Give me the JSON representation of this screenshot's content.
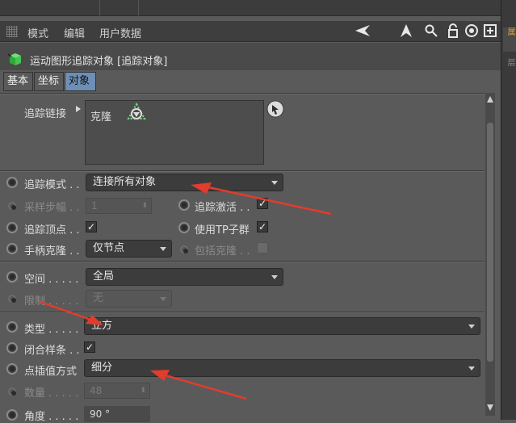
{
  "menu": {
    "mode": "模式",
    "edit": "编辑",
    "user_data": "用户数据"
  },
  "object": {
    "title": "运动图形追踪对象 [追踪对象]"
  },
  "tabs": [
    "基本",
    "坐标",
    "对象"
  ],
  "fields": {
    "trace_link_label": "追踪链接",
    "trace_link_item": "克隆",
    "trace_mode_label": "追踪模式 . .",
    "trace_mode_value": "连接所有对象",
    "sample_step_label": "采样步幅 . .",
    "sample_step_value": "1",
    "trace_active_label": "追踪激活 . .",
    "trace_vertex_label": "追踪顶点 . .",
    "use_tp_label": "使用TP子群",
    "handle_clone_label": "手柄克隆 . .",
    "handle_clone_value": "仅节点",
    "include_clone_label": "包括克隆 . .",
    "space_label": "空间 . . . . .",
    "space_value": "全局",
    "limit_label": "限制 . . . . .",
    "limit_value": "无",
    "type_label": "类型 . . . . .",
    "type_value": "立方",
    "closed_spline_label": "闭合样条 . .",
    "interp_label": "点插值方式",
    "interp_value": "细分",
    "count_label": "数量 . . . . .",
    "count_value": "48",
    "angle_label": "角度 . . . . .",
    "angle_value": "90 °"
  },
  "checks": {
    "check_mark": "✓"
  },
  "colors": {
    "arrow": "#e23c2c",
    "tab_active": "#6d8fb5",
    "accent": "#e0a030"
  }
}
